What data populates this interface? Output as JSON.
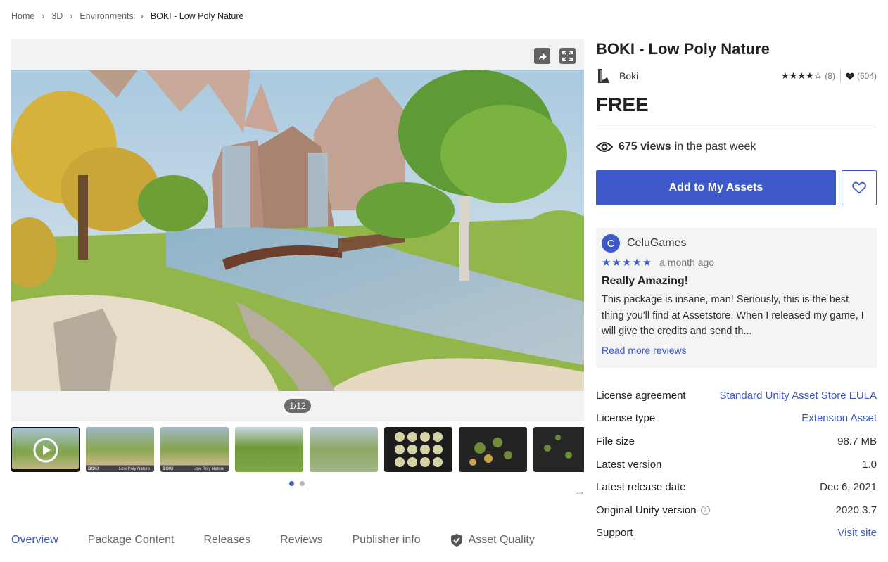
{
  "breadcrumb": {
    "items": [
      "Home",
      "3D",
      "Environments"
    ],
    "current": "BOKI - Low Poly Nature"
  },
  "media": {
    "counter": "1/12",
    "icons": [
      "share-icon",
      "fullscreen-icon",
      "play-icon",
      "arrow-right-icon"
    ]
  },
  "thumbnails": {
    "count": 8,
    "active_index": 0,
    "pages": 2,
    "active_page": 0,
    "labels": [
      "BOKI",
      "Low Poly Nature"
    ]
  },
  "product": {
    "title": "BOKI - Low Poly Nature",
    "publisher": "Boki",
    "rating_stars": "★★★★☆",
    "rating_count": "(8)",
    "favorites": "(604)",
    "price": "FREE",
    "views_count": "675 views",
    "views_suffix": "in the past week",
    "add_button": "Add to My Assets"
  },
  "review": {
    "avatar_letter": "C",
    "author": "CeluGames",
    "stars": "★★★★★",
    "time": "a month ago",
    "title": "Really Amazing!",
    "body": "This package is insane, man! Seriously, this is the best thing you'll find at Assetstore. When I released my game, I will give the credits and send th...",
    "read_more": "Read more reviews"
  },
  "details": [
    {
      "key": "License agreement",
      "value": "Standard Unity Asset Store EULA",
      "link": true
    },
    {
      "key": "License type",
      "value": "Extension Asset",
      "link": true
    },
    {
      "key": "File size",
      "value": "98.7 MB",
      "link": false
    },
    {
      "key": "Latest version",
      "value": "1.0",
      "link": false
    },
    {
      "key": "Latest release date",
      "value": "Dec 6, 2021",
      "link": false
    },
    {
      "key": "Original Unity version",
      "value": "2020.3.7",
      "link": false
    },
    {
      "key": "Support",
      "value": "Visit site",
      "link": true
    }
  ],
  "tabs": [
    "Overview",
    "Package Content",
    "Releases",
    "Reviews",
    "Publisher info",
    "Asset Quality"
  ],
  "colors": {
    "accent": "#3d59c9",
    "text": "#212121",
    "muted": "#666666"
  }
}
